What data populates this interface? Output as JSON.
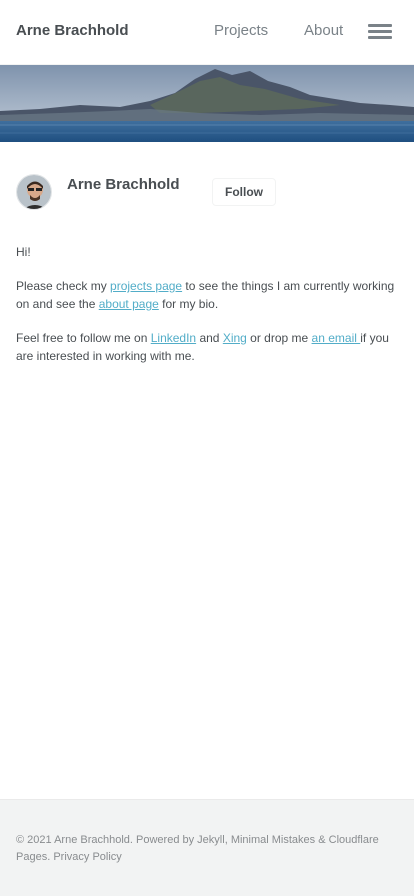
{
  "masthead": {
    "site_title": "Arne Brachhold",
    "nav": [
      "Projects",
      "About"
    ],
    "menu_icon": "hamburger-menu-icon"
  },
  "hero": {
    "image": "coastal-mountain-landscape"
  },
  "author": {
    "name": "Arne Brachhold",
    "follow_label": "Follow",
    "avatar_icon": "avatar-photo"
  },
  "content": {
    "greeting": "Hi!",
    "p1_before": "Please check my ",
    "p1_link1": "projects page",
    "p1_middle": " to see the things I am currently working on and see the ",
    "p1_link2": "about page",
    "p1_after": " for my bio.",
    "p2_before": "Feel free to follow me on ",
    "p2_link1": "LinkedIn",
    "p2_and": " and ",
    "p2_link2": "Xing",
    "p2_middle": " or drop me ",
    "p2_link3": "an email ",
    "p2_after": "if you are interested in working with me."
  },
  "footer": {
    "copyright": "© 2021 Arne Brachhold. Powered by ",
    "link_jekyll": "Jekyll",
    "sep1": ", ",
    "link_mm": "Minimal Mistakes",
    "sep2": " & ",
    "link_cf": "Cloudflare Pages",
    "sep3": ". ",
    "link_privacy": "Privacy Policy"
  },
  "colors": {
    "link": "#52adc8",
    "text": "#494e52",
    "footer_bg": "#f2f3f3"
  }
}
